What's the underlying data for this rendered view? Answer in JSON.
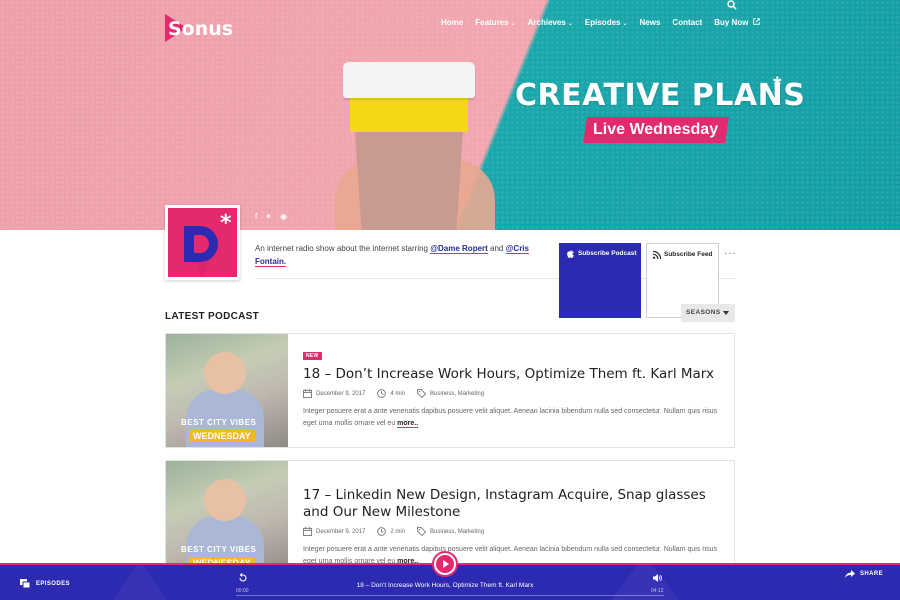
{
  "brand": {
    "logo_text": "Sonus",
    "accent": "#e5296f",
    "primary": "#2c2ab0"
  },
  "nav": {
    "items": [
      {
        "label": "Home",
        "has_caret": false
      },
      {
        "label": "Features",
        "has_caret": true
      },
      {
        "label": "Archieves",
        "has_caret": true
      },
      {
        "label": "Episodes",
        "has_caret": true
      },
      {
        "label": "News",
        "has_caret": false
      },
      {
        "label": "Contact",
        "has_caret": false
      },
      {
        "label": "Buy Now",
        "has_caret": false
      }
    ],
    "search_icon": "search-icon"
  },
  "hero": {
    "title": "CREATIVE PLANS",
    "title_mark": "*",
    "ribbon": "Live Wednesday"
  },
  "show": {
    "description_prefix": "An internet radio show about the internet starring ",
    "host1": "@Dame Ropert",
    "connector": " and ",
    "host2": "@Cris Fontain.",
    "subscribe_podcast": "Subscribe Podcast",
    "subscribe_feed": "Subscribe Feed",
    "more": "···",
    "seasons_label": "SEASONS",
    "social_icons": [
      "facebook-icon",
      "twitter-icon",
      "instagram-icon"
    ]
  },
  "section_title": "LATEST PODCAST",
  "episodes": [
    {
      "badge": "NEW",
      "title": "18 – Don’t Increase Work Hours, Optimize Them ft. Karl Marx",
      "date": "December 9, 2017",
      "duration": "4 min",
      "categories": "Business, Marketing",
      "excerpt": "Integer posuere erat a ante venenatis dapibus posuere velit aliquet. Aenean lacinia bibendum nulla sed consectetur. Nullam quis risus eget urna mollis ornare vel eu ",
      "more": "more..",
      "thumb_caption_top": "BEST CITY VIBES",
      "thumb_caption_bottom": "WEDNESDAY"
    },
    {
      "badge": "",
      "title": "17 – Linkedin New Design, Instagram Acquire, Snap glasses and Our New Milestone",
      "date": "December 9, 2017",
      "duration": "2 min",
      "categories": "Business, Marketing",
      "excerpt": "Integer posuere erat a ante venenatis dapibus posuere velit aliquet. Aenean lacinia bibendum nulla sed consectetur. Nullam quis risus eget urna mollis ornare vel eu ",
      "more": "more..",
      "thumb_caption_top": "BEST CITY VIBES",
      "thumb_caption_bottom": "WEDNESDAY"
    }
  ],
  "player": {
    "episodes_label": "EPISODES",
    "now_playing": "18 – Don’t Increase Work Hours, Optimize Them ft. Karl Marx",
    "time_current": "00:00",
    "time_total": "04:12",
    "progress_fraction": 0,
    "share_label": "SHARE"
  }
}
